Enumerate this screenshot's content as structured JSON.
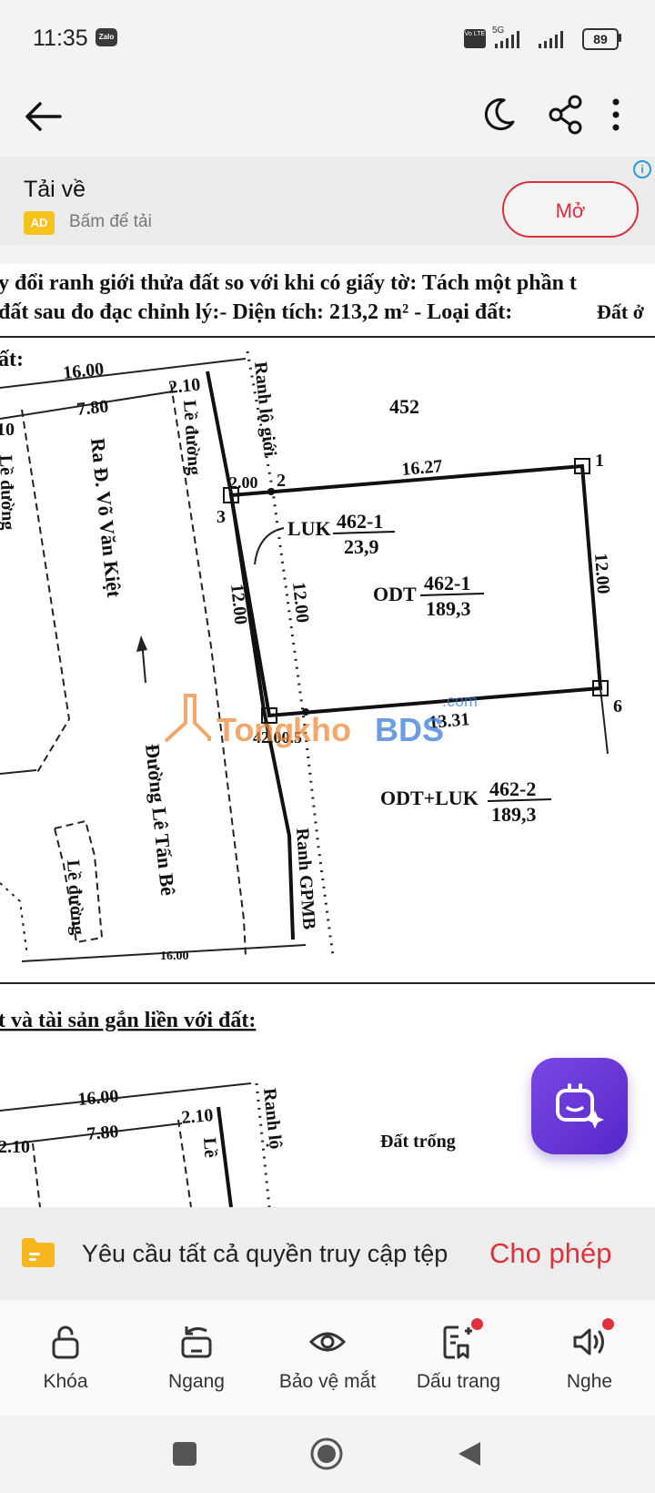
{
  "status_bar": {
    "time": "11:35",
    "zalo_label": "Zalo",
    "volte_label": "Vo LTE",
    "network": "5G",
    "battery": "89"
  },
  "ad": {
    "title": "Tải về",
    "badge": "AD",
    "subtitle": "Bấm để tải",
    "open_button": "Mở",
    "info_label": "i"
  },
  "document": {
    "header_line1": "y đổi ranh giới thửa đất so với khi có giấy tờ: Tách một phần t",
    "header_line2_a": "đất sau đo đạc chỉnh lý:- Diện tích: 213,2 m² - Loại đất:",
    "header_line2_b": "Đất ở",
    "section1_label": "ất:",
    "section2_label": "t và tài sản gắn liền với đất:",
    "plot_number": "452",
    "dim_16_00": "16.00",
    "dim_7_80": "7.80",
    "dim_2_10": "2.10",
    "dim_10": "10",
    "dim_16_27": "16.27",
    "dim_12_00": "12.00",
    "dim_13_31": "13.31",
    "dim_2_00": "2.00",
    "dim_16_bottom": "16.00",
    "dim_2_10_b": "2.10",
    "dim_4_2_00_5": "42.00.5",
    "pt1": "1",
    "pt2": "2",
    "pt3": "3",
    "pt6": "6",
    "label_ranh_lo_gioi": "Ranh lộ giới",
    "label_ranh_lo_short": "Ranh lộ",
    "label_ranh_gpmb": "Ranh GPMB",
    "label_le_duong": "Lề đường",
    "label_le_short": "Lề",
    "label_ra_vo_van_kiet": "Ra Đ. Võ Văn Kiệt",
    "label_duong_le_tan_be": "Đường Lê Tấn Bê",
    "luk_prefix": "LUK",
    "luk_num": "462-1",
    "luk_area": "23,9",
    "odt_prefix": "ODT",
    "odt_num": "462-1",
    "odt_area": "189,3",
    "mix_prefix": "ODT+LUK",
    "mix_num": "462-2",
    "mix_area": "189,3",
    "dat_trong": "Đất trống",
    "watermark_a": "Tong",
    "watermark_b": "kho",
    "watermark_c": "BDS",
    "watermark_com": ".com"
  },
  "permission": {
    "message": "Yêu cầu tất cả quyền truy cập tệp",
    "allow": "Cho phép"
  },
  "bottom_nav": [
    {
      "label": "Khóa",
      "icon": "lock-icon"
    },
    {
      "label": "Ngang",
      "icon": "rotate-icon"
    },
    {
      "label": "Bảo vệ mắt",
      "icon": "eye-icon"
    },
    {
      "label": "Dấu trang",
      "icon": "bookmark-add-icon"
    },
    {
      "label": "Nghe",
      "icon": "speaker-icon"
    }
  ],
  "colors": {
    "accent_red": "#e0313a",
    "fab_purple": "#6a3ad8",
    "badge_yellow": "#f5c31b",
    "watermark_orange": "#f08a3c",
    "watermark_blue": "#3a7dd6"
  }
}
